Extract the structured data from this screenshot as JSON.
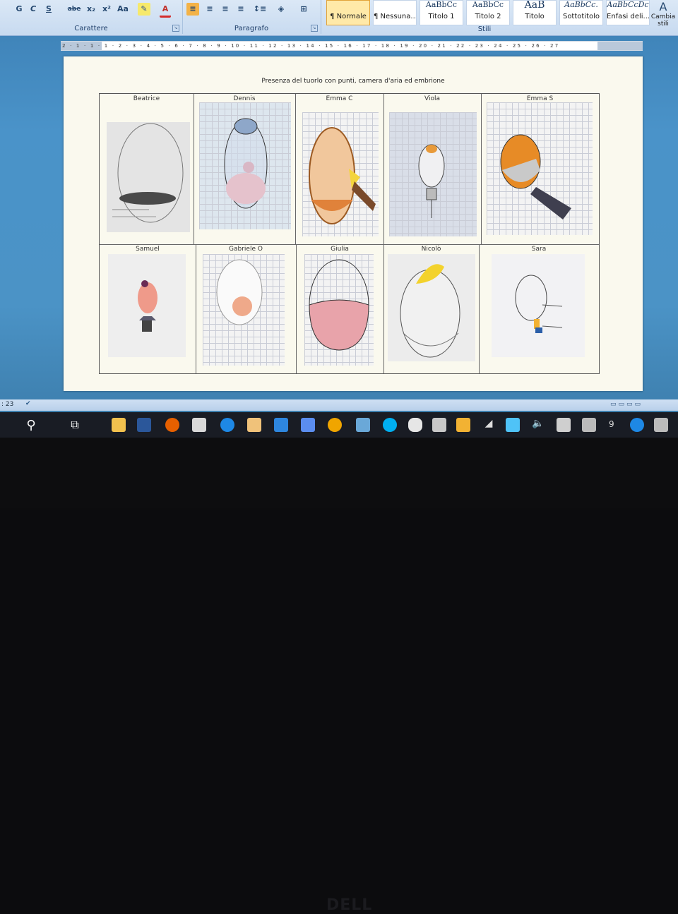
{
  "ribbon": {
    "font_buttons": [
      "G",
      "C",
      "S",
      "abe",
      "x₂",
      "x²",
      "Aa"
    ],
    "carattere_label": "Carattere",
    "paragrafo_label": "Paragrafo",
    "stili_label": "Stili",
    "styles": [
      {
        "preview": "",
        "name": "¶ Normale"
      },
      {
        "preview": "",
        "name": "¶ Nessuna..."
      },
      {
        "preview": "AaBbCc",
        "name": "Titolo 1"
      },
      {
        "preview": "AaBbCc",
        "name": "Titolo 2"
      },
      {
        "preview": "AaB",
        "name": "Titolo"
      },
      {
        "preview": "AaBbCc.",
        "name": "Sottotitolo"
      },
      {
        "preview": "AaBbCcDc",
        "name": "Enfasi deli..."
      }
    ],
    "change_styles": "Cambia stili"
  },
  "ruler": {
    "labels": "2 · 1 · 1 · 1 · 2 · 3 · 4 · 5 · 6 · 7 · 8 · 9 · 10 · 11 · 12 · 13 · 14 · 15 · 16 · 17 · 18 · 19 · 20 · 21 · 22 · 23 · 24 · 25 · 26 · 27"
  },
  "document": {
    "heading": "Presenza del tuorlo con punti, camera d'aria ed embrione",
    "row1": [
      "Beatrice",
      "Dennis",
      "Emma C",
      "Viola",
      "Emma S"
    ],
    "row2": [
      "Samuel",
      "Gabriele O",
      "Giulia",
      "Nicolò",
      "Sara"
    ]
  },
  "statusbar": {
    "left": ": 23"
  },
  "taskbar": {
    "clock": "9"
  },
  "laptop": {
    "brand": "DELL"
  },
  "colors": {
    "accent": "#2b579a",
    "selected_style": "#ffe9a8"
  }
}
